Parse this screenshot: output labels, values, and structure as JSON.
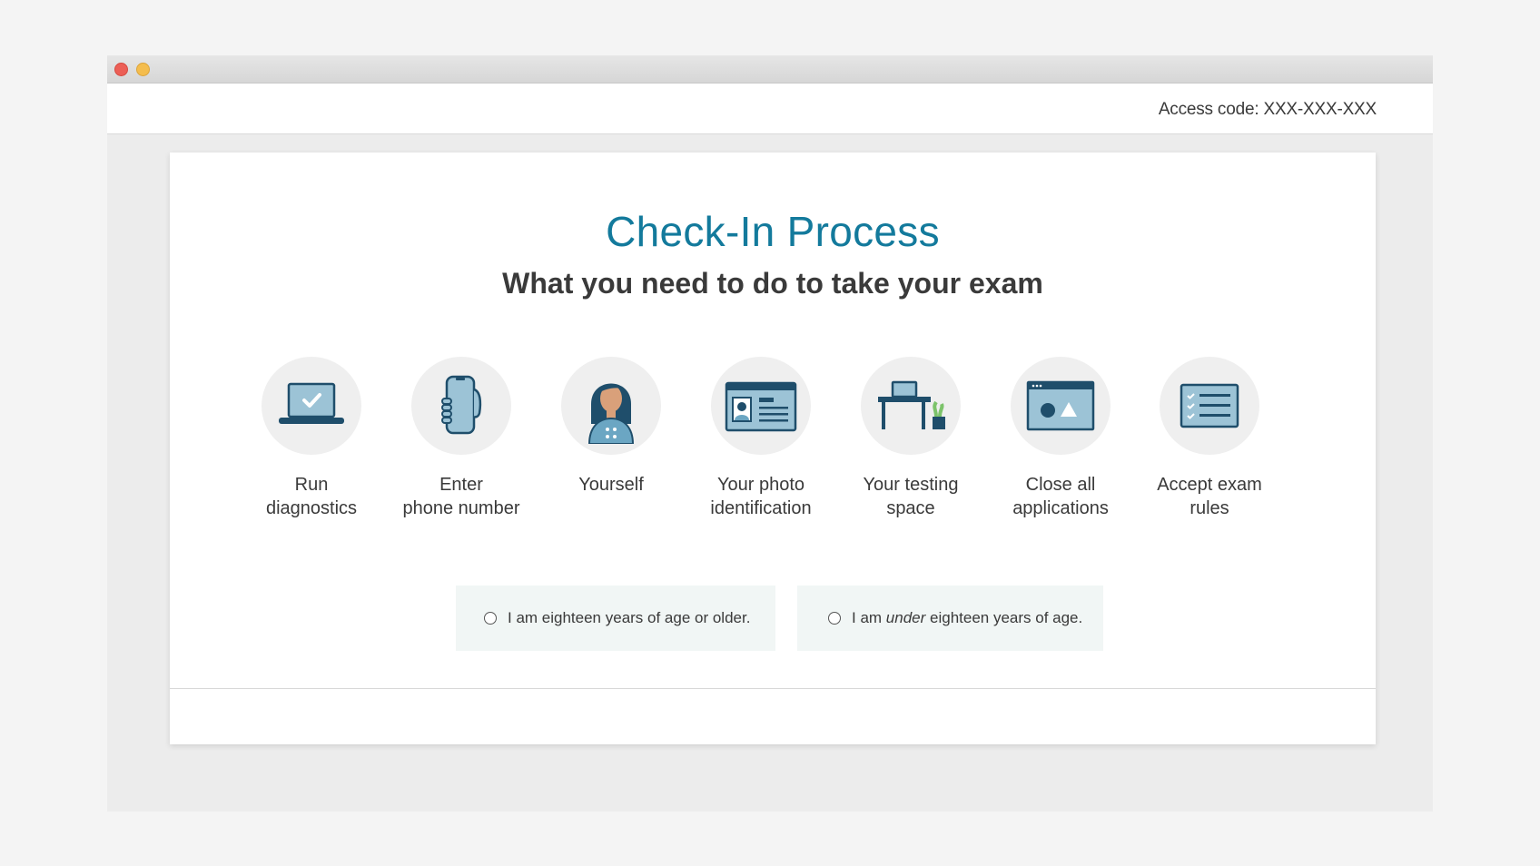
{
  "header": {
    "access_code": "Access code: XXX-XXX-XXX"
  },
  "main": {
    "title": "Check-In Process",
    "subtitle": "What you need to do to take your exam",
    "steps": [
      {
        "label": "Run\ndiagnostics",
        "icon": "laptop-check-icon"
      },
      {
        "label": "Enter\nphone number",
        "icon": "phone-in-hand-icon"
      },
      {
        "label": "Yourself",
        "icon": "person-icon"
      },
      {
        "label": "Your photo\nidentification",
        "icon": "id-card-icon"
      },
      {
        "label": "Your testing\nspace",
        "icon": "desk-icon"
      },
      {
        "label": "Close all\napplications",
        "icon": "app-window-icon"
      },
      {
        "label": "Accept exam\nrules",
        "icon": "checklist-icon"
      }
    ],
    "age_options": [
      {
        "before": "I am eighteen years of age or older.",
        "emph": "",
        "after": ""
      },
      {
        "before": "I am ",
        "emph": "under",
        "after": " eighteen years of age."
      }
    ]
  },
  "colors": {
    "title": "#137a9c",
    "icon_dark": "#1f4e6b",
    "icon_light": "#9cc3d6",
    "option_bg": "#f1f6f5"
  }
}
